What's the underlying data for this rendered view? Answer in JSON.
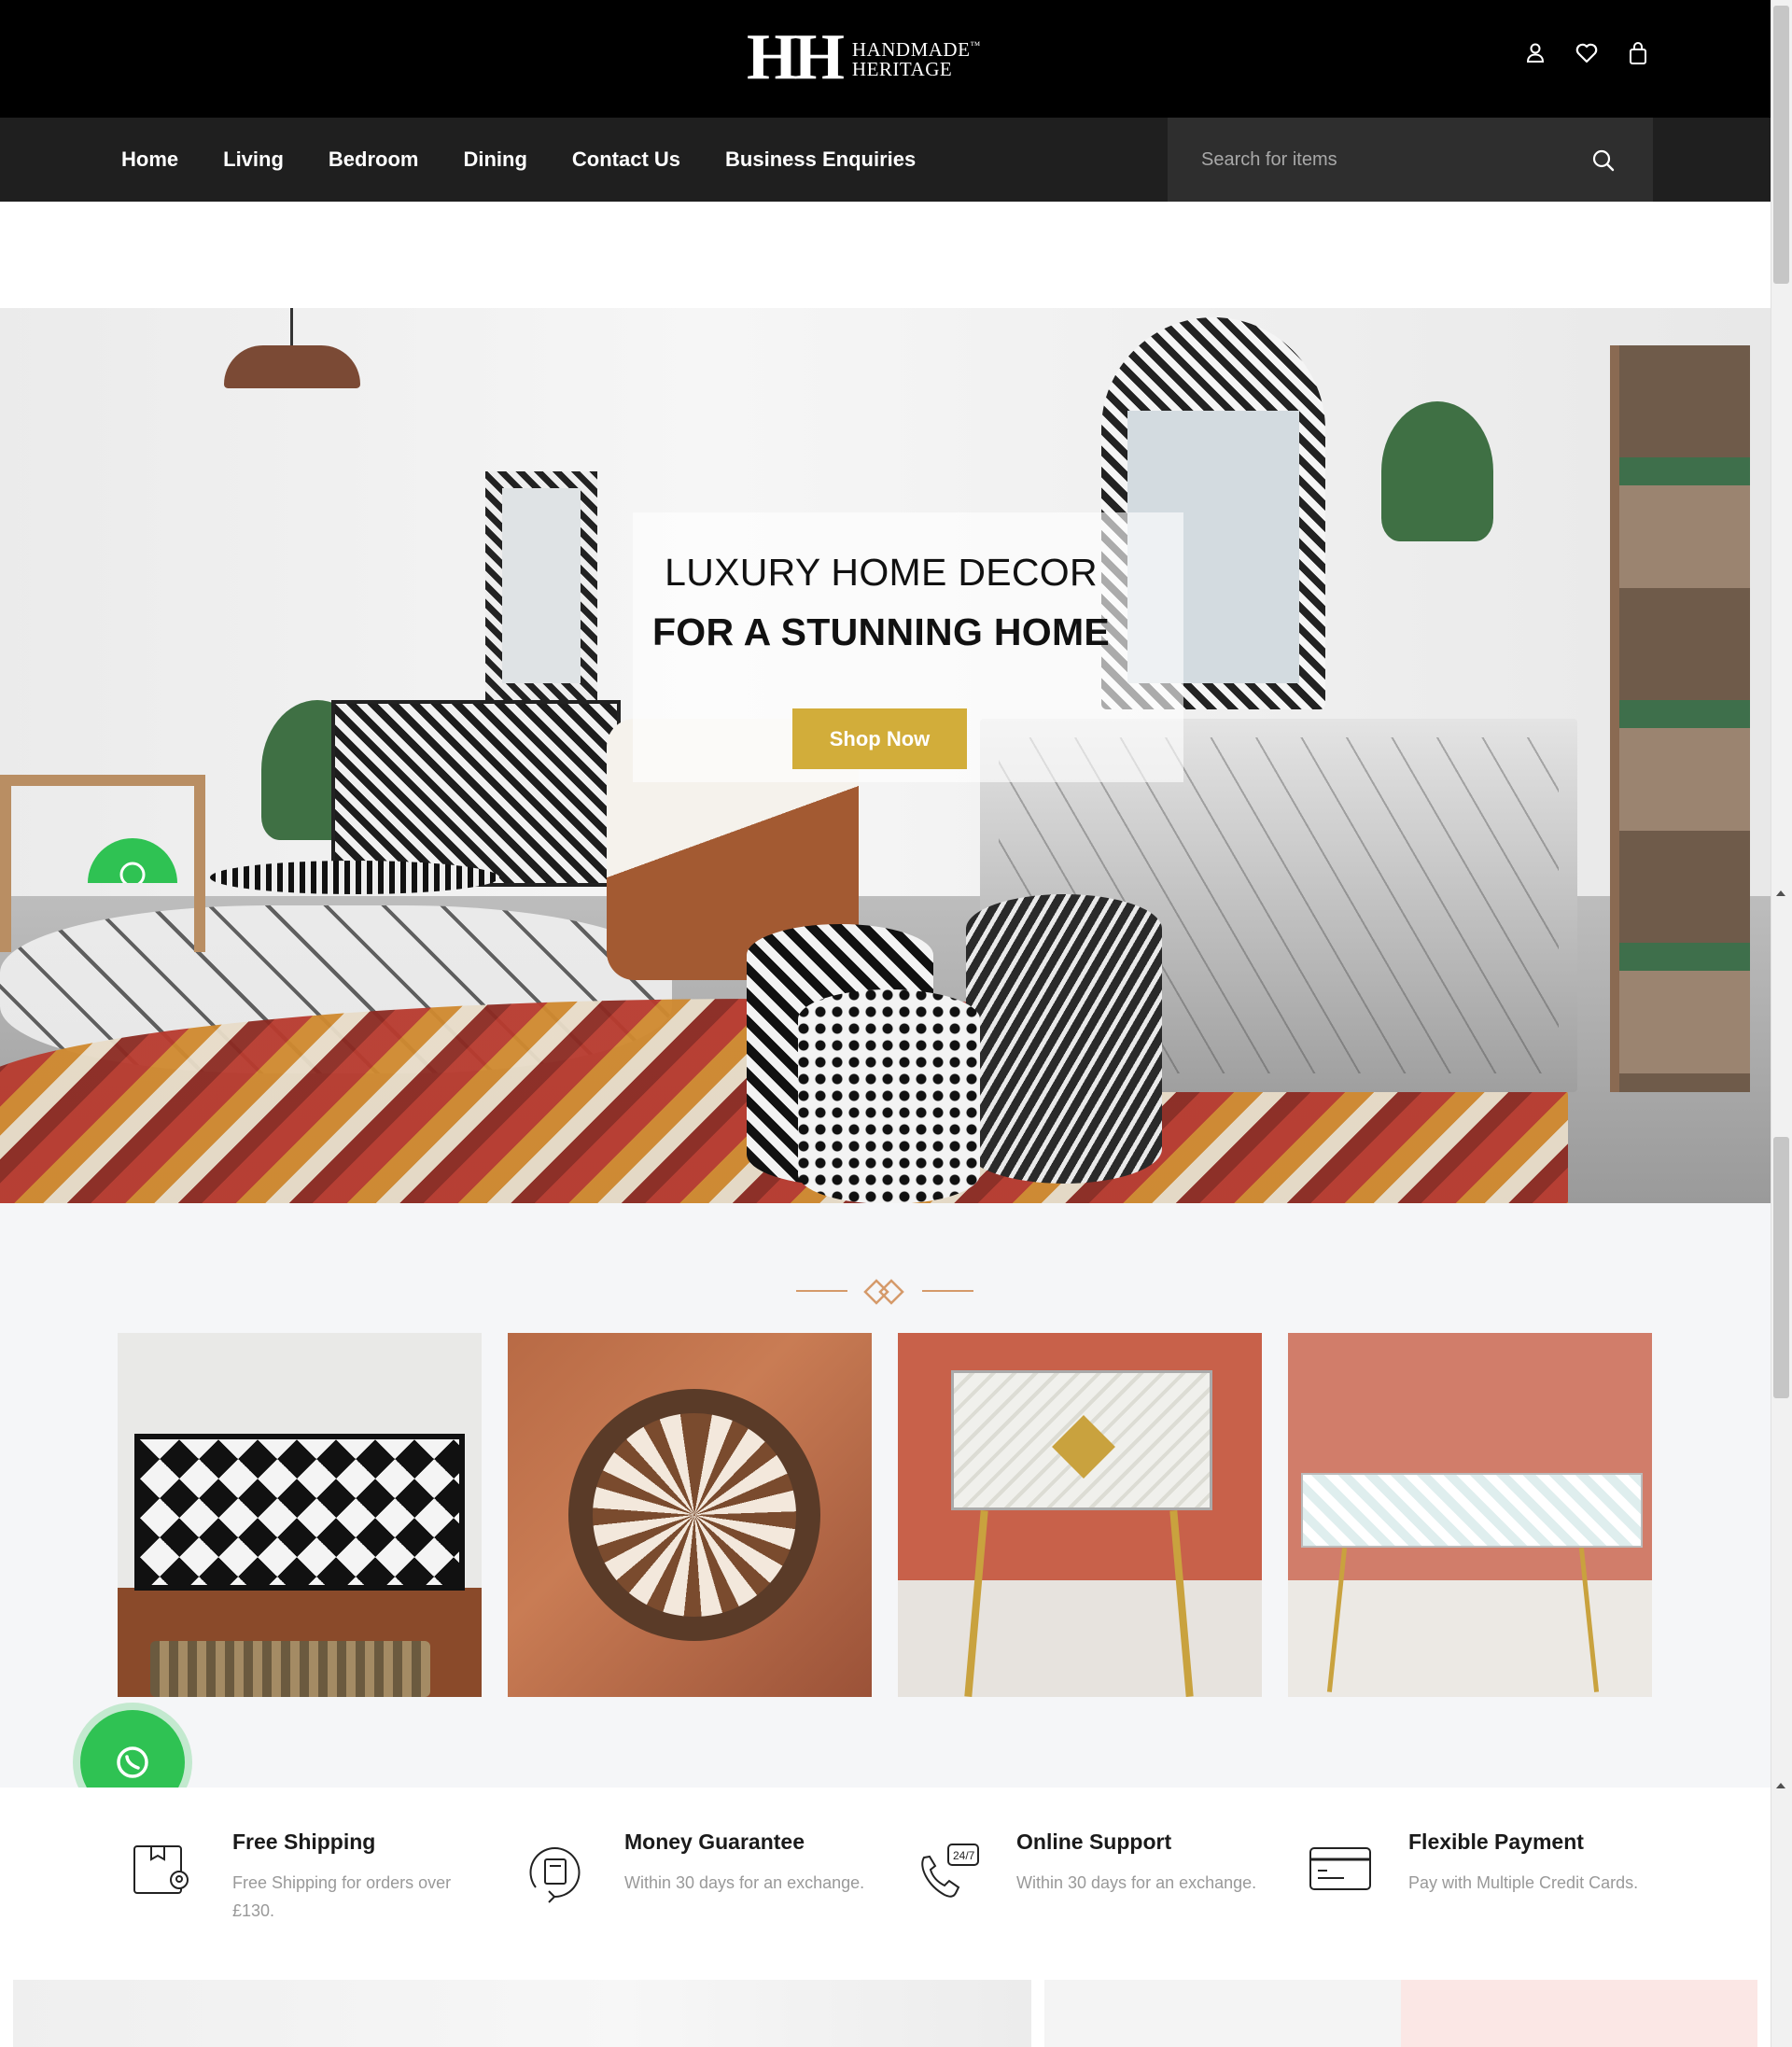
{
  "brand": {
    "mark": "HH",
    "name_line1": "HANDMADE",
    "trademark": "™",
    "name_line2": "HERITAGE"
  },
  "header_icons": [
    "user-icon",
    "heart-icon",
    "bag-icon"
  ],
  "nav": {
    "items": [
      "Home",
      "Living",
      "Bedroom",
      "Dining",
      "Contact Us",
      "Business Enquiries"
    ]
  },
  "search": {
    "placeholder": "Search for items",
    "value": ""
  },
  "hero": {
    "line1": "LUXURY HOME DECOR",
    "line2": "FOR A STUNNING HOME",
    "cta": "Shop Now",
    "cta_color": "#d2ad3a"
  },
  "collections": {
    "accent_color": "#d59a6a",
    "items": [
      "sideboard-image",
      "tray-image",
      "bedside-table-image",
      "desk-image"
    ]
  },
  "features": [
    {
      "icon": "shipping-box-icon",
      "title": "Free Shipping",
      "desc": "Free Shipping for orders over £130."
    },
    {
      "icon": "money-return-icon",
      "title": "Money Guarantee",
      "desc": "Within 30 days for an exchange."
    },
    {
      "icon": "support-phone-icon",
      "title": "Online Support",
      "desc": "Within 30 days for an exchange."
    },
    {
      "icon": "credit-card-icon",
      "title": "Flexible Payment",
      "desc": "Pay with Multiple Credit Cards."
    }
  ],
  "whatsapp_color": "#2fc253"
}
